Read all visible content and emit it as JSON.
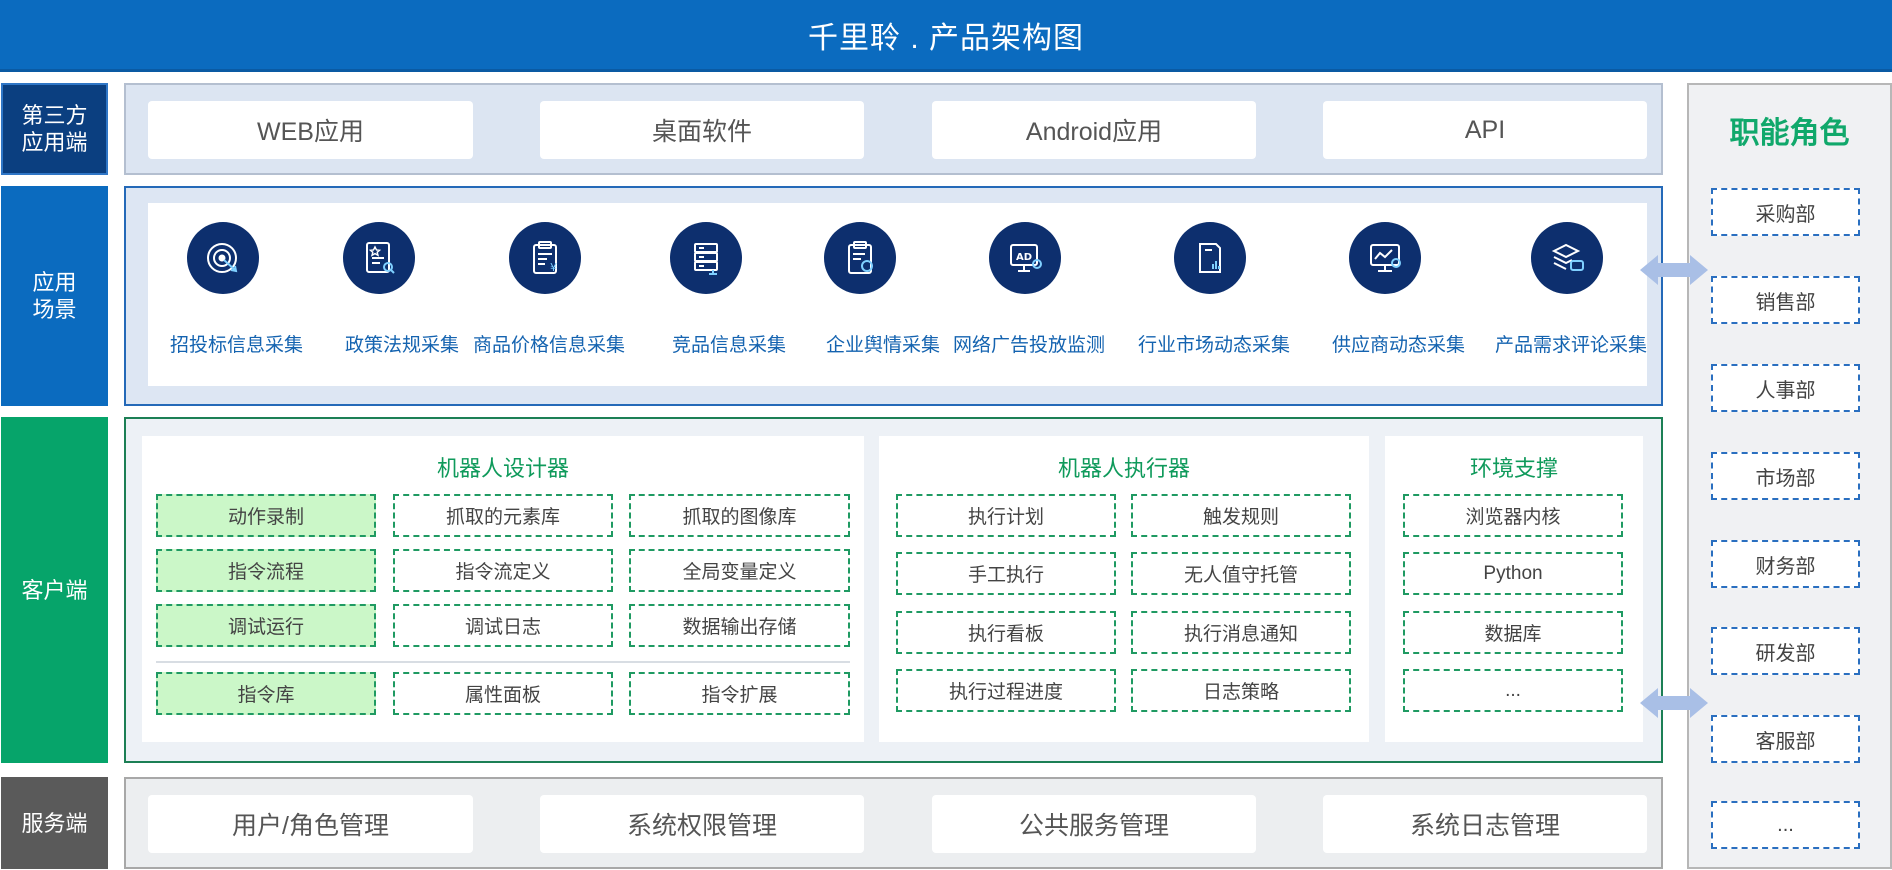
{
  "title": "千里聆 . 产品架构图",
  "layers": {
    "third_party": "第三方\n应用端",
    "scenarios": "应用\n场景",
    "client": "客户端",
    "server": "服务端"
  },
  "third_party_apps": [
    "WEB应用",
    "桌面软件",
    "Android应用",
    "API"
  ],
  "scenarios": [
    {
      "label": "招投标信息采集",
      "icon": "target-icon"
    },
    {
      "label": "政策法规采集",
      "icon": "document-search-icon"
    },
    {
      "label": "商品价格信息采集",
      "icon": "clipboard-price-icon"
    },
    {
      "label": "竞品信息采集",
      "icon": "server-icon"
    },
    {
      "label": "企业舆情采集",
      "icon": "clipboard-user-icon"
    },
    {
      "label": "网络广告投放监测",
      "icon": "ad-monitor-icon"
    },
    {
      "label": "行业市场动态采集",
      "icon": "chart-document-icon"
    },
    {
      "label": "供应商动态采集",
      "icon": "monitor-chart-icon"
    },
    {
      "label": "产品需求评论采集",
      "icon": "layers-chat-icon"
    }
  ],
  "client": {
    "designer": {
      "title": "机器人设计器",
      "rows": [
        [
          "动作录制",
          "抓取的元素库",
          "抓取的图像库"
        ],
        [
          "指令流程",
          "指令流定义",
          "全局变量定义"
        ],
        [
          "调试运行",
          "调试日志",
          "数据输出存储"
        ]
      ],
      "bottom_row": [
        "指令库",
        "属性面板",
        "指令扩展"
      ]
    },
    "executor": {
      "title": "机器人执行器",
      "rows": [
        [
          "执行计划",
          "触发规则"
        ],
        [
          "手工执行",
          "无人值守托管"
        ],
        [
          "执行看板",
          "执行消息通知"
        ],
        [
          "执行过程进度",
          "日志策略"
        ]
      ]
    },
    "environment": {
      "title": "环境支撑",
      "items": [
        "浏览器内核",
        "Python",
        "数据库",
        "..."
      ]
    }
  },
  "server_items": [
    "用户/角色管理",
    "系统权限管理",
    "公共服务管理",
    "系统日志管理"
  ],
  "roles": {
    "title": "职能角色",
    "items": [
      "采购部",
      "销售部",
      "人事部",
      "市场部",
      "财务部",
      "研发部",
      "客服部",
      "..."
    ]
  },
  "colors": {
    "title_bar": "#0b6bbf",
    "accent_green": "#10a86b",
    "icon_navy": "#0d2f6e",
    "highlight_cell": "#cbf7c8"
  }
}
